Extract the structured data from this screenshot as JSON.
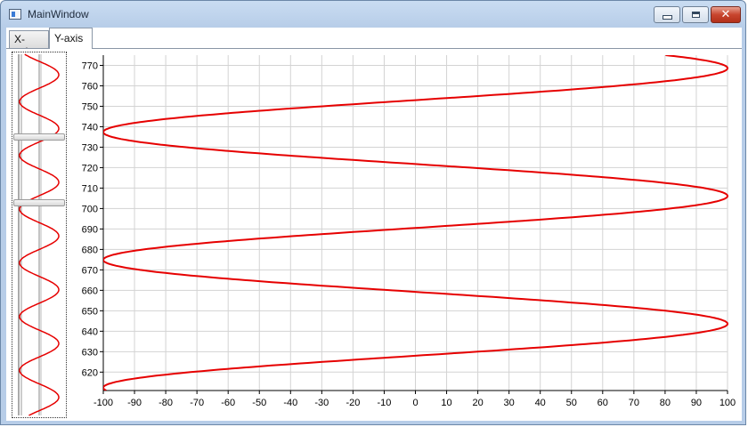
{
  "window": {
    "title": "MainWindow",
    "icons": [
      "window-icon",
      "minimize-icon",
      "maximize-icon",
      "close-icon"
    ]
  },
  "tabs": [
    {
      "label": "X-axis",
      "selected": false
    },
    {
      "label": "Y-axis",
      "selected": true
    }
  ],
  "overview": {
    "selection_start": 0.23,
    "selection_end": 0.41
  },
  "chart_data": {
    "type": "line",
    "title": "",
    "xlabel": "",
    "ylabel": "",
    "xlim": [
      -100,
      100
    ],
    "ylim": [
      611,
      775
    ],
    "grid": true,
    "x_ticks": [
      -100,
      -90,
      -80,
      -70,
      -60,
      -50,
      -40,
      -30,
      -20,
      -10,
      0,
      10,
      20,
      30,
      40,
      50,
      60,
      70,
      80,
      90,
      100
    ],
    "y_ticks": [
      620,
      630,
      640,
      650,
      660,
      670,
      680,
      690,
      700,
      710,
      720,
      730,
      740,
      750,
      760,
      770
    ],
    "series": [
      {
        "color": "#e60000",
        "function": "x = 100*sin(2*pi*(y - 628)/62.5)",
        "points": [
          {
            "x": 0,
            "y": 628
          },
          {
            "x": 100,
            "y": 643.6
          },
          {
            "x": 0,
            "y": 659.3
          },
          {
            "x": -100,
            "y": 674.9
          },
          {
            "x": 0,
            "y": 690.5
          },
          {
            "x": 100,
            "y": 706.1
          },
          {
            "x": 0,
            "y": 721.8
          },
          {
            "x": -100,
            "y": 737.4
          },
          {
            "x": 0,
            "y": 753
          },
          {
            "x": 100,
            "y": 768.6
          }
        ]
      }
    ]
  }
}
